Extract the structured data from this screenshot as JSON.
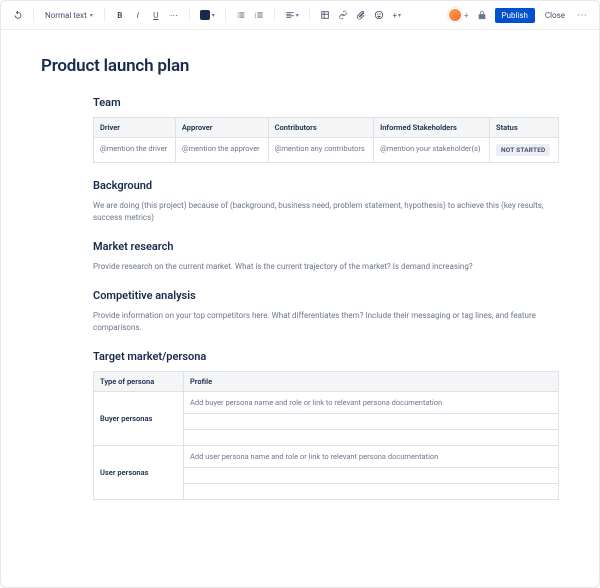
{
  "toolbar": {
    "textStyle": "Normal text",
    "publish": "Publish",
    "close": "Close"
  },
  "page": {
    "title": "Product launch plan"
  },
  "sections": {
    "team": "Team",
    "background": "Background",
    "backgroundText": "We are doing (this project) because of (background, business need, problem statement, hypothesis) to achieve this (key results, success metrics)",
    "market": "Market research",
    "marketText": "Provide research on the current market. What is the current trajectory of the market? Is demand increasing?",
    "competitive": "Competitive analysis",
    "competitiveText": "Provide information on your top competitors here. What differentiates them? Include their messaging or tag lines, and feature comparisons.",
    "persona": "Target market/persona"
  },
  "teamTable": {
    "headers": {
      "driver": "Driver",
      "approver": "Approver",
      "contributors": "Contributors",
      "stakeholders": "Informed Stakeholders",
      "status": "Status"
    },
    "row": {
      "driver": "@mention the driver",
      "approver": "@mention the approver",
      "contributors": "@mention any contributors",
      "stakeholders": "@mention your stakeholder(s)",
      "status": "NOT STARTED"
    }
  },
  "personaTable": {
    "headers": {
      "type": "Type of persona",
      "profile": "Profile"
    },
    "rows": {
      "buyer": {
        "label": "Buyer personas",
        "text": "Add buyer persona name and role or link to relevant persona documentation"
      },
      "user": {
        "label": "User personas",
        "text": "Add user persona name and role or link to relevant persona documentation"
      }
    }
  }
}
